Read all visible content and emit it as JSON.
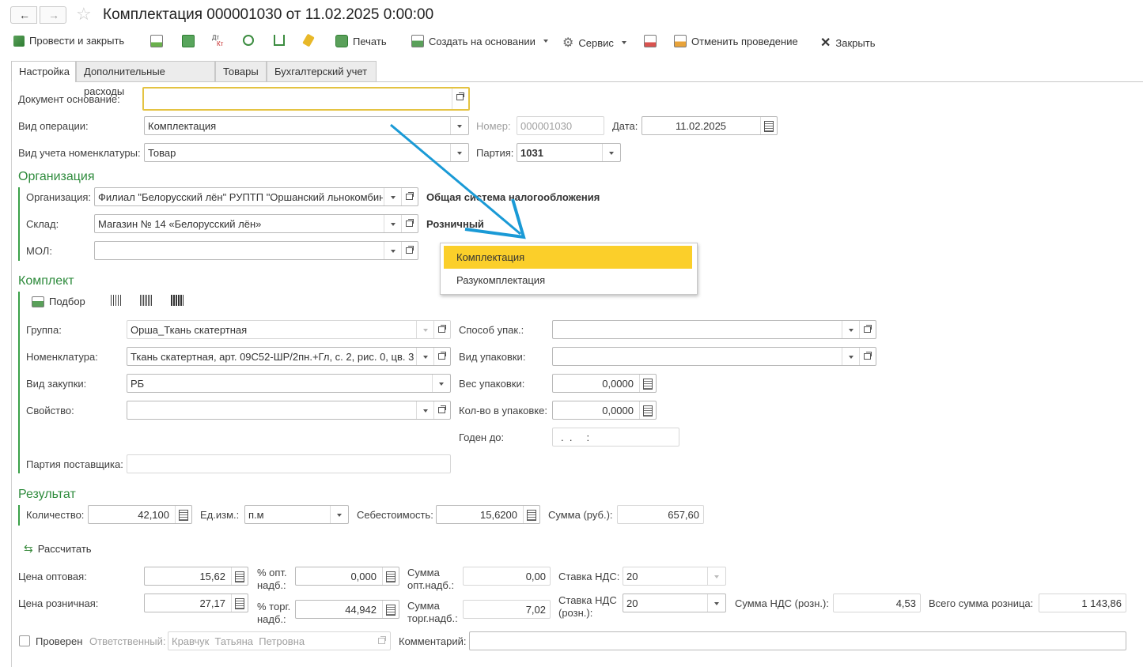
{
  "window": {
    "title": "Комплектация 000001030 от 11.02.2025 0:00:00"
  },
  "toolbar": {
    "post_close": "Провести и закрыть",
    "print": "Печать",
    "create_based_on": "Создать на основании",
    "service": "Сервис",
    "cancel_posting": "Отменить проведение",
    "close": "Закрыть",
    "dt_kt_top": "Дт",
    "dt_kt_bottom": "Кт"
  },
  "tabs": [
    {
      "label": "Настройка"
    },
    {
      "label": "Дополнительные расходы"
    },
    {
      "label": "Товары"
    },
    {
      "label": "Бухгалтерский учет"
    }
  ],
  "header": {
    "base_doc_label": "Документ основание:",
    "base_doc_value": "",
    "op_type_label": "Вид операции:",
    "op_type_value": "Комплектация",
    "number_label": "Номер:",
    "number_value": "000001030",
    "date_label": "Дата:",
    "date_value": "11.02.2025",
    "nom_account_label": "Вид учета номенклатуры:",
    "nom_account_value": "Товар",
    "batch_label": "Партия:",
    "batch_value": "1031"
  },
  "org": {
    "section": "Организация",
    "org_label": "Организация:",
    "org_value": "Филиал \"Белорусский лён\" РУПТП \"Оршанский льнокомбинат\"",
    "tax_system": "Общая система налогообложения",
    "warehouse_label": "Склад:",
    "warehouse_value": "Магазин № 14 «Белорусский лён»",
    "warehouse_type": "Розничный",
    "mol_label": "МОЛ:",
    "mol_value": ""
  },
  "dropdown": {
    "items": [
      "Комплектация",
      "Разукомплектация"
    ],
    "selected": 0
  },
  "kit": {
    "section": "Комплект",
    "pick_label": "Подбор",
    "group_label": "Группа:",
    "group_value": "Орша_Ткань скатертная",
    "nomenclature_label": "Номенклатура:",
    "nomenclature_value": "Ткань скатертная, арт. 09С52-ШР/2пн.+Гл, с. 2, рис. 0, цв. 3",
    "purchase_type_label": "Вид закупки:",
    "purchase_type_value": "РБ",
    "property_label": "Свойство:",
    "property_value": "",
    "supplier_batch_label": "Партия поставщика:",
    "supplier_batch_value": "",
    "pack_method_label": "Способ упак.:",
    "pack_method_value": "",
    "pack_type_label": "Вид упаковки:",
    "pack_type_value": "",
    "pack_weight_label": "Вес упаковки:",
    "pack_weight_value": "0,0000",
    "qty_in_pack_label": "Кол-во в упаковке:",
    "qty_in_pack_value": "0,0000",
    "valid_until_label": "Годен до:",
    "valid_until_value": ".  .     :"
  },
  "result": {
    "section": "Результат",
    "qty_label": "Количество:",
    "qty_value": "42,100",
    "unit_label": "Ед.изм.:",
    "unit_value": "п.м",
    "cost_label": "Себестоимость:",
    "cost_value": "15,6200",
    "sum_label": "Сумма (руб.):",
    "sum_value": "657,60"
  },
  "calc": {
    "recalc_label": "Рассчитать",
    "wholesale_price_label": "Цена оптовая:",
    "wholesale_price_value": "15,62",
    "wholesale_markup_label_1": "% опт.",
    "wholesale_markup_label_2": "надб.:",
    "wholesale_markup_value": "0,000",
    "wholesale_markup_sum_label_1": "Сумма",
    "wholesale_markup_sum_label_2": "опт.надб.:",
    "wholesale_markup_sum_value": "0,00",
    "vat_rate_label": "Ставка НДС:",
    "vat_rate_value": "20",
    "retail_price_label": "Цена розничная:",
    "retail_price_value": "27,17",
    "retail_markup_label_1": "% торг.",
    "retail_markup_label_2": "надб.:",
    "retail_markup_value": "44,942",
    "retail_markup_sum_label_1": "Сумма",
    "retail_markup_sum_label_2": "торг.надб.:",
    "retail_markup_sum_value": "7,02",
    "retail_vat_rate_label_1": "Ставка НДС",
    "retail_vat_rate_label_2": "(розн.):",
    "retail_vat_rate_value": "20",
    "retail_vat_sum_label": "Сумма НДС (розн.):",
    "retail_vat_sum_value": "4,53",
    "retail_total_label": "Всего сумма розница:",
    "retail_total_value": "1 143,86"
  },
  "footer": {
    "checked_label": "Проверен",
    "checked": false,
    "responsible_label": "Ответственный:",
    "responsible_value": "Кравчук  Татьяна  Петровна",
    "comment_label": "Комментарий:",
    "comment_value": ""
  },
  "colors": {
    "accent": "#2e8b3c",
    "highlight": "#f5c518",
    "arrow": "#1a9ad6"
  }
}
